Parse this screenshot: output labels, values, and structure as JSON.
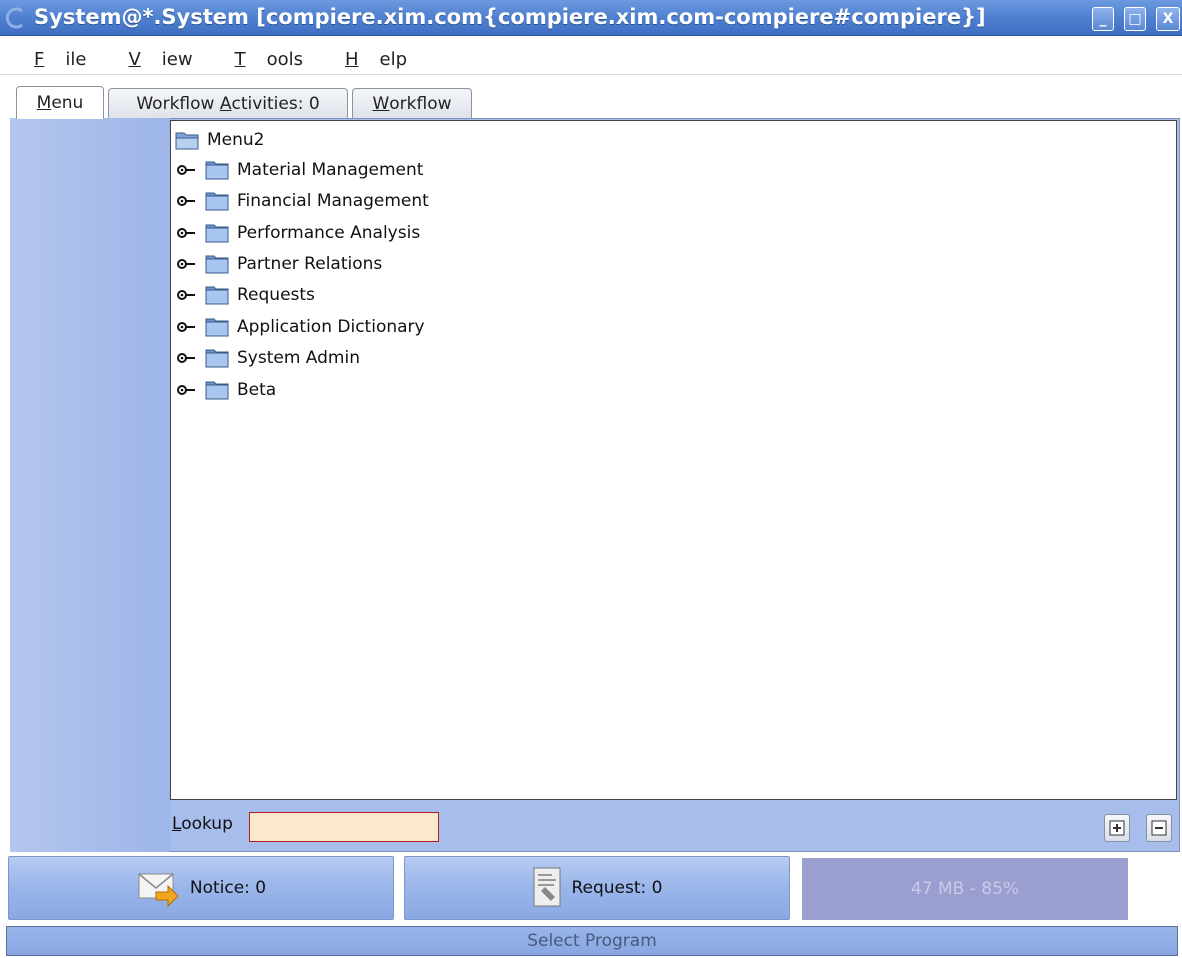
{
  "window": {
    "title": "System@*.System [compiere.xim.com{compiere.xim.com-compiere#compiere}]",
    "minimize_label": "_",
    "maximize_label": "□",
    "close_label": "X"
  },
  "menubar": {
    "items": [
      {
        "mnemonic": "F",
        "rest": "ile"
      },
      {
        "mnemonic": "V",
        "rest": "iew"
      },
      {
        "mnemonic": "T",
        "rest": "ools"
      },
      {
        "mnemonic": "H",
        "rest": "elp"
      }
    ]
  },
  "tabs": {
    "menu": {
      "mnemonic": "M",
      "rest": "enu"
    },
    "workflow_activities": {
      "pre": "Workflow ",
      "mnemonic": "A",
      "rest": "ctivities: 0"
    },
    "workflow": {
      "mnemonic": "W",
      "rest": "orkflow"
    }
  },
  "tree": {
    "root": "Menu2",
    "nodes": [
      "Material Management",
      "Financial Management",
      "Performance Analysis",
      "Partner Relations",
      "Requests",
      "Application Dictionary",
      "System Admin",
      "Beta"
    ]
  },
  "lookup": {
    "mnemonic": "L",
    "rest": "ookup",
    "value": ""
  },
  "expand_all_label": "+",
  "collapse_all_label": "−",
  "bottom": {
    "notice": "Notice: 0",
    "request": "Request: 0",
    "memory": "47 MB - 85%"
  },
  "status": "Select Program",
  "colors": {
    "title_bar": "#4f80d0",
    "panel_bg": "#a7bdeb",
    "lookup_bg": "#fbe8cd",
    "lookup_border": "#b91d1d",
    "memory_bg": "#9a9fd0"
  }
}
